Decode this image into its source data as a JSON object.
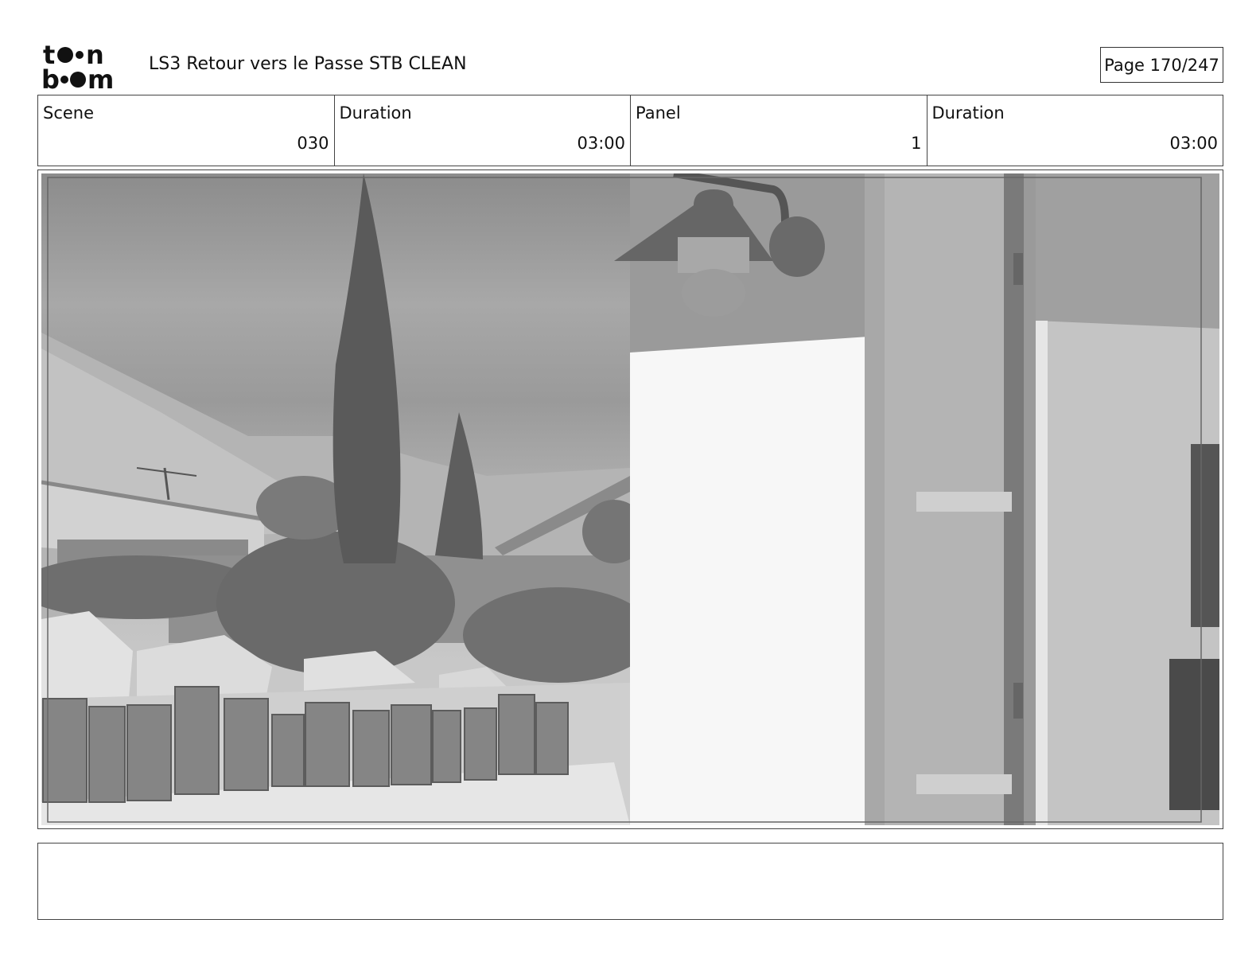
{
  "header": {
    "project_title": "LS3 Retour vers le Passe STB CLEAN",
    "page_label": "Page 170/247"
  },
  "info": [
    {
      "label": "Scene",
      "value": "030"
    },
    {
      "label": "Duration",
      "value": "03:00"
    },
    {
      "label": "Panel",
      "value": "1"
    },
    {
      "label": "Duration",
      "value": "03:00"
    }
  ],
  "notes": ""
}
